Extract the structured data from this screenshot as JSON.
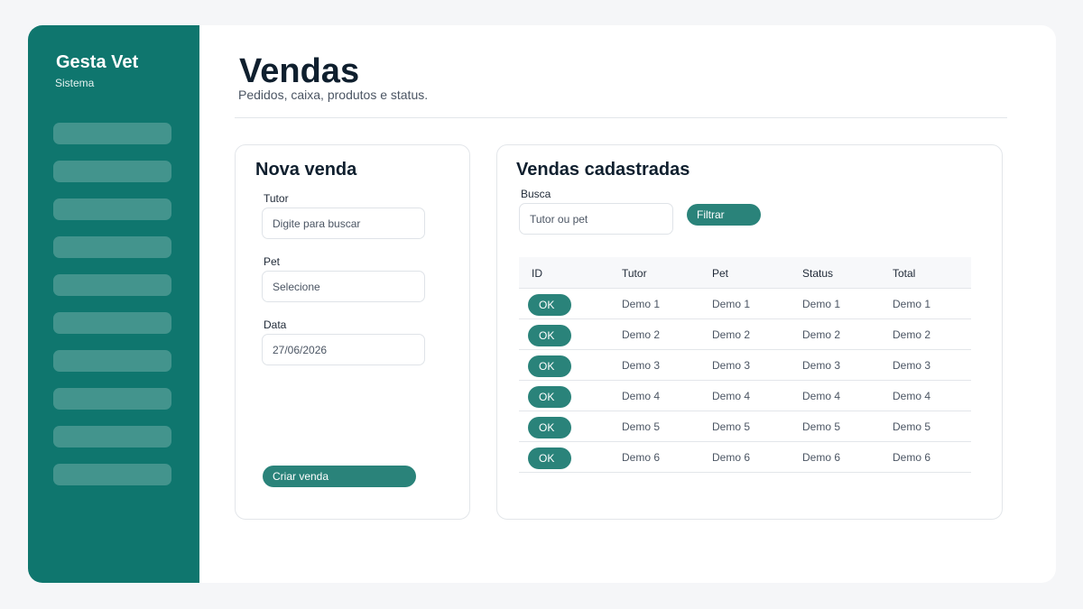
{
  "sidebar": {
    "title": "Gesta Vet",
    "subtitle": "Sistema",
    "item_count": 10
  },
  "header": {
    "title": "Vendas",
    "subtitle": "Pedidos, caixa, produtos e status."
  },
  "new_sale": {
    "title": "Nova venda",
    "tutor_label": "Tutor",
    "tutor_placeholder": "Digite para buscar",
    "pet_label": "Pet",
    "pet_placeholder": "Selecione",
    "date_label": "Data",
    "date_value": "27/06/2026",
    "create_label": "Criar venda"
  },
  "sales_list": {
    "title": "Vendas cadastradas",
    "search_label": "Busca",
    "search_placeholder": "Tutor ou pet",
    "filter_label": "Filtrar",
    "columns": [
      "ID",
      "Tutor",
      "Pet",
      "Status",
      "Total"
    ],
    "rows": [
      {
        "id": "OK",
        "tutor": "Demo 1",
        "pet": "Demo 1",
        "status": "Demo 1",
        "total": "Demo 1"
      },
      {
        "id": "OK",
        "tutor": "Demo 2",
        "pet": "Demo 2",
        "status": "Demo 2",
        "total": "Demo 2"
      },
      {
        "id": "OK",
        "tutor": "Demo 3",
        "pet": "Demo 3",
        "status": "Demo 3",
        "total": "Demo 3"
      },
      {
        "id": "OK",
        "tutor": "Demo 4",
        "pet": "Demo 4",
        "status": "Demo 4",
        "total": "Demo 4"
      },
      {
        "id": "OK",
        "tutor": "Demo 5",
        "pet": "Demo 5",
        "status": "Demo 5",
        "total": "Demo 5"
      },
      {
        "id": "OK",
        "tutor": "Demo 6",
        "pet": "Demo 6",
        "status": "Demo 6",
        "total": "Demo 6"
      }
    ]
  },
  "colors": {
    "sidebar": "#0f766e",
    "accent": "#2a837a",
    "background": "#f5f6f8",
    "text_dark": "#0f1f2e"
  }
}
